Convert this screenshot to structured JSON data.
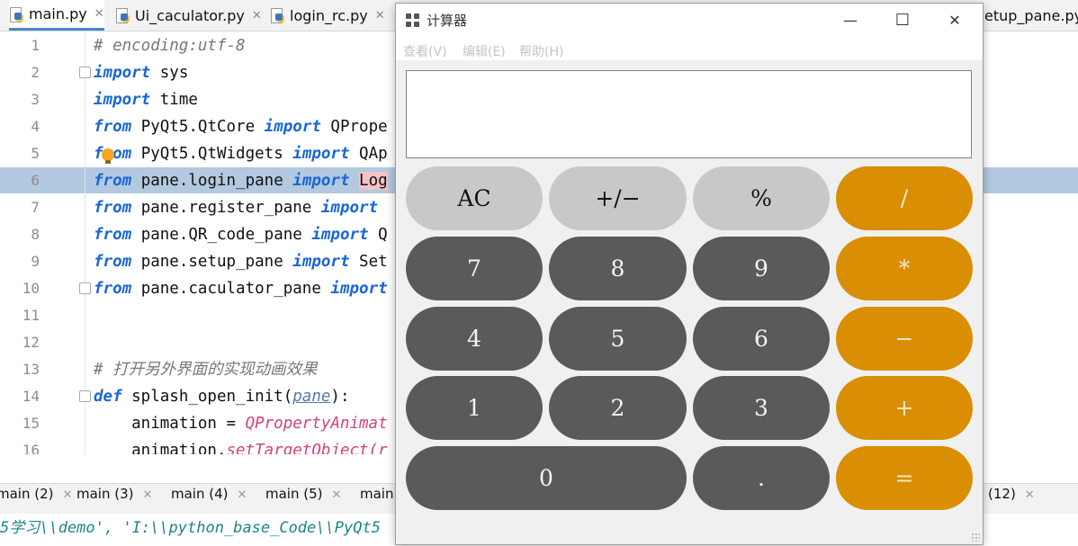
{
  "ide": {
    "tabs": [
      {
        "label": "main.py",
        "active": true
      },
      {
        "label": "Ui_caculator.py",
        "active": false
      },
      {
        "label": "login_rc.py",
        "active": false
      },
      {
        "label": "etup_pane.py",
        "active": false
      }
    ],
    "line_numbers": [
      "1",
      "2",
      "3",
      "4",
      "5",
      "6",
      "7",
      "8",
      "9",
      "10",
      "11",
      "12",
      "13",
      "14",
      "15",
      "16"
    ],
    "code": {
      "l1_comment": "# encoding:utf-8",
      "l2_kw": "import",
      "l2_rest": " sys",
      "l3_kw": "import",
      "l3_rest": " time",
      "l4_kw1": "from",
      "l4_mod": " PyQt5.QtCore ",
      "l4_kw2": "import",
      "l4_rest": " QPrope",
      "l5_kw1": "from",
      "l5_mod": " PyQt5.QtWidgets ",
      "l5_kw2": "import",
      "l5_rest": " QAp",
      "l6_kw1": "from",
      "l6_mod": " pane.login_pane ",
      "l6_kw2": "import",
      "l6_rest": "Log",
      "l7_kw1": "from",
      "l7_mod": " pane.register_pane ",
      "l7_kw2": "import",
      "l8_kw1": "from",
      "l8_mod": " pane.QR_code_pane ",
      "l8_kw2": "import",
      "l8_rest": " Q",
      "l9_kw1": "from",
      "l9_mod": " pane.setup_pane ",
      "l9_kw2": "import",
      "l9_rest": " Set",
      "l10_kw1": "from",
      "l10_mod": " pane.caculator_pane ",
      "l10_kw2": "import",
      "l13_comment": "# 打开另外界面的实现动画效果",
      "l14_kw": "def",
      "l14_name": " splash_open_init(",
      "l14_param": "pane",
      "l14_end": "):",
      "l15_var": "    animation = ",
      "l15_call": "QPropertyAnimat",
      "l16_var": "    animation.",
      "l16_call": "setTargetObject(",
      "l16_tail": "r"
    },
    "bottom_tabs": [
      "main (2)",
      "main (3)",
      "main (4)",
      "main (5)",
      "main"
    ],
    "bottom_tab_right": "(12)",
    "console_text": "5学习\\\\demo', 'I:\\\\python_base_Code\\\\PyQt5"
  },
  "window": {
    "title": "计算器",
    "minimize_glyph": "—",
    "maximize_glyph": "☐",
    "close_glyph": "✕",
    "menus": [
      "查看(V)",
      "编辑(E)",
      "帮助(H)"
    ],
    "display_value": ""
  },
  "keys": {
    "row1": [
      "AC",
      "+/−",
      "%",
      "/"
    ],
    "row2": [
      "7",
      "8",
      "9",
      "*"
    ],
    "row3": [
      "4",
      "5",
      "6",
      "−"
    ],
    "row4": [
      "1",
      "2",
      "3",
      "+"
    ],
    "row5": [
      "0",
      ".",
      "="
    ]
  },
  "colors": {
    "function_key": "#c8c8c8",
    "number_key": "#5a5a5a",
    "operator_key": "#d98e04",
    "line_highlight": "#a5bfd9",
    "keyword": "#1a66d8"
  },
  "icons": {
    "app_icon": "grid-icon",
    "tab_icon": "python-file-icon",
    "bulb": "lightbulb-icon"
  }
}
